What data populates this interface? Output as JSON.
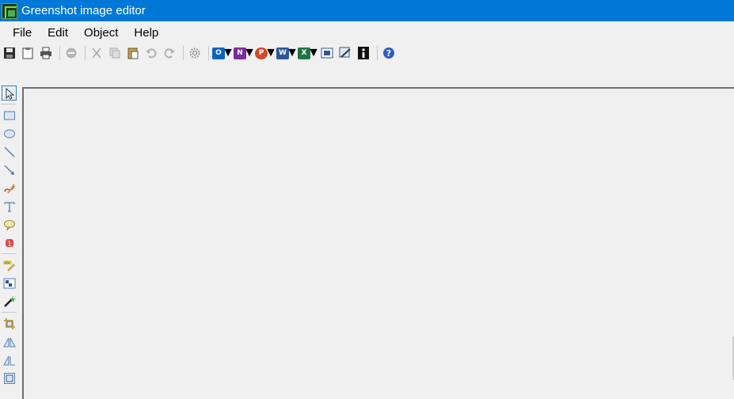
{
  "window": {
    "title": "Greenshot image editor"
  },
  "menu": {
    "items": [
      "File",
      "Edit",
      "Object",
      "Help"
    ]
  },
  "toolbar": {
    "buttons": [
      {
        "name": "save-icon"
      },
      {
        "name": "clipboard-icon"
      },
      {
        "name": "print-icon"
      },
      {
        "name": "delete-icon"
      },
      {
        "name": "cut-icon"
      },
      {
        "name": "copy-icon"
      },
      {
        "name": "paste-icon"
      },
      {
        "name": "undo-icon"
      },
      {
        "name": "redo-icon"
      },
      {
        "name": "settings-gear-icon"
      },
      {
        "name": "outlook-icon",
        "letter": "O",
        "color": "#0a64c8"
      },
      {
        "name": "onenote-icon",
        "letter": "N",
        "color": "#7b2c9e"
      },
      {
        "name": "powerpoint-icon",
        "letter": "P",
        "color": "#d24726"
      },
      {
        "name": "word-icon",
        "letter": "W",
        "color": "#2b579a"
      },
      {
        "name": "excel-icon",
        "letter": "X",
        "color": "#217346"
      },
      {
        "name": "resize-canvas-icon"
      },
      {
        "name": "image-properties-icon"
      },
      {
        "name": "info-icon"
      },
      {
        "name": "help-icon"
      }
    ]
  },
  "tools": [
    "select-pointer-icon",
    "rectangle-icon",
    "ellipse-icon",
    "line-icon",
    "arrow-icon",
    "freehand-icon",
    "text-icon",
    "speech-bubble-icon",
    "step-counter-icon",
    "highlight-icon",
    "obfuscate-icon",
    "magic-wand-icon",
    "crop-icon",
    "rotate-icon",
    "flip-icon",
    "auto-crop-icon"
  ],
  "colors": {
    "titlebar": "#0078d7",
    "background": "#f0f0f0"
  }
}
